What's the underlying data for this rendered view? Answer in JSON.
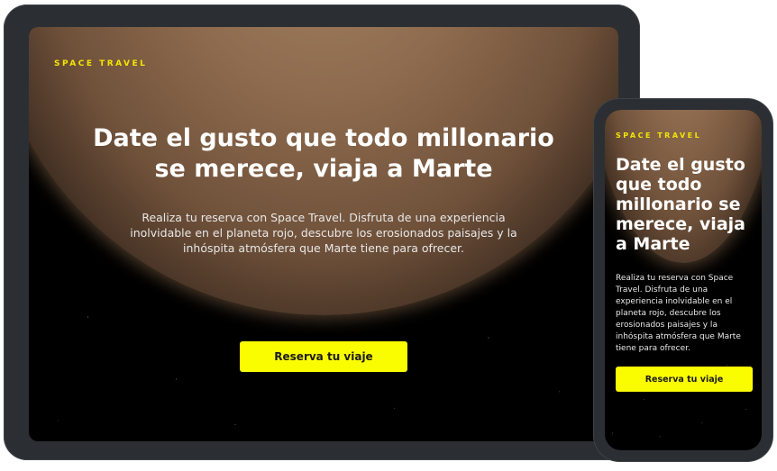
{
  "brand": "SPACE TRAVEL",
  "hero": {
    "tablet_headline": "Date el gusto que todo millonario se merece, viaja a Marte",
    "phone_headline": "Date el gusto que todo millonario se merece, viaja a Marte",
    "description": "Realiza tu reserva con Space Travel. Disfruta de una experiencia inolvidable en el planeta rojo, descubre los erosionados paisajes y la inhóspita atmósfera que Marte tiene para ofrecer.",
    "cta_label": "Reserva tu viaje"
  },
  "colors": {
    "accent": "#f3e600",
    "button": "#fafc00",
    "device_frame": "#2b2f33",
    "background": "#000000"
  }
}
